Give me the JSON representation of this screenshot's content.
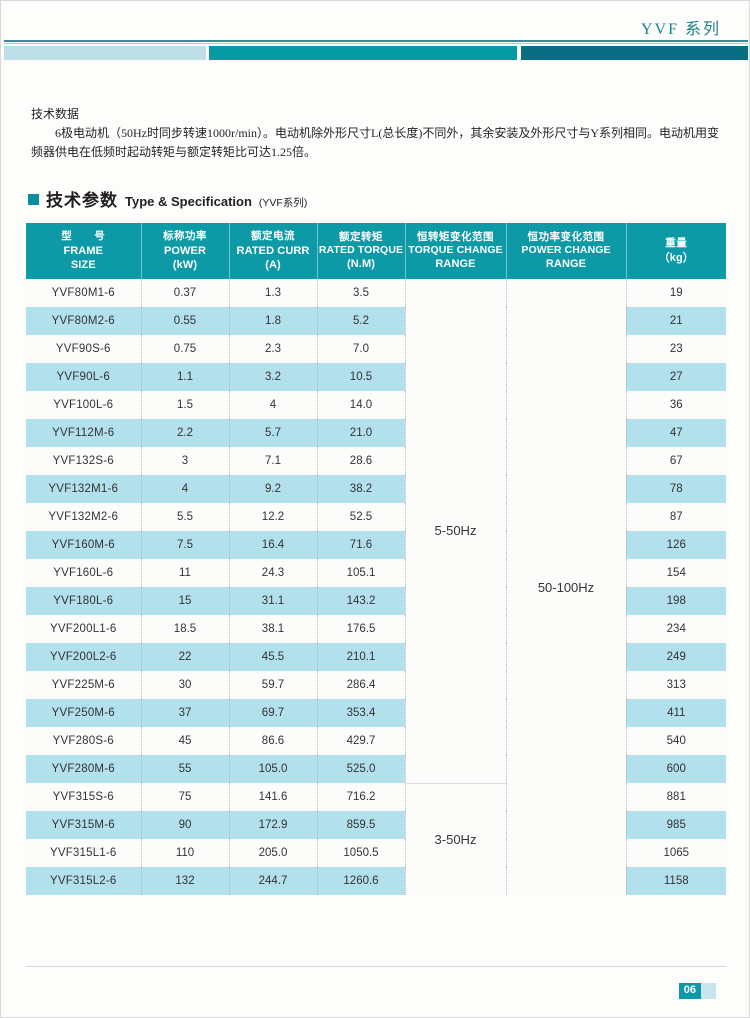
{
  "header": {
    "title": "YVF 系列"
  },
  "intro": {
    "title": "技术数据",
    "body": "6极电动机（50Hz时同步转速1000r/min）。电动机除外形尺寸L(总长度)不同外，其余安装及外形尺寸与Y系列相同。电动机用变频器供电在低频时起动转矩与额定转矩比可达1.25倍。"
  },
  "section": {
    "cn": "技术参数",
    "en": "Type & Specification",
    "sub": "(YVF系列)"
  },
  "table": {
    "columns": [
      {
        "cn": "型　　号",
        "en1": "FRAME",
        "en2": "SIZE"
      },
      {
        "cn": "标称功率",
        "en1": "POWER",
        "en2": "(kW)"
      },
      {
        "cn": "额定电流",
        "en1": "RATED CURR",
        "en2": "(A)"
      },
      {
        "cn": "额定转矩",
        "en1": "RATED TORQUE",
        "en2": "(N.M)"
      },
      {
        "cn": "恒转矩变化范围",
        "en1": "TORQUE CHANGE",
        "en2": "RANGE"
      },
      {
        "cn": "恒功率变化范围",
        "en1": "POWER CHANGE",
        "en2": "RANGE"
      },
      {
        "cn": "重量",
        "en1": "（kg）",
        "en2": ""
      }
    ],
    "rows": [
      {
        "frame": "YVF80M1-6",
        "power": "0.37",
        "current": "1.3",
        "torque": "3.5",
        "weight": "19"
      },
      {
        "frame": "YVF80M2-6",
        "power": "0.55",
        "current": "1.8",
        "torque": "5.2",
        "weight": "21"
      },
      {
        "frame": "YVF90S-6",
        "power": "0.75",
        "current": "2.3",
        "torque": "7.0",
        "weight": "23"
      },
      {
        "frame": "YVF90L-6",
        "power": "1.1",
        "current": "3.2",
        "torque": "10.5",
        "weight": "27"
      },
      {
        "frame": "YVF100L-6",
        "power": "1.5",
        "current": "4",
        "torque": "14.0",
        "weight": "36"
      },
      {
        "frame": "YVF112M-6",
        "power": "2.2",
        "current": "5.7",
        "torque": "21.0",
        "weight": "47"
      },
      {
        "frame": "YVF132S-6",
        "power": "3",
        "current": "7.1",
        "torque": "28.6",
        "weight": "67"
      },
      {
        "frame": "YVF132M1-6",
        "power": "4",
        "current": "9.2",
        "torque": "38.2",
        "weight": "78"
      },
      {
        "frame": "YVF132M2-6",
        "power": "5.5",
        "current": "12.2",
        "torque": "52.5",
        "weight": "87"
      },
      {
        "frame": "YVF160M-6",
        "power": "7.5",
        "current": "16.4",
        "torque": "71.6",
        "weight": "126"
      },
      {
        "frame": "YVF160L-6",
        "power": "11",
        "current": "24.3",
        "torque": "105.1",
        "weight": "154"
      },
      {
        "frame": "YVF180L-6",
        "power": "15",
        "current": "31.1",
        "torque": "143.2",
        "weight": "198"
      },
      {
        "frame": "YVF200L1-6",
        "power": "18.5",
        "current": "38.1",
        "torque": "176.5",
        "weight": "234"
      },
      {
        "frame": "YVF200L2-6",
        "power": "22",
        "current": "45.5",
        "torque": "210.1",
        "weight": "249"
      },
      {
        "frame": "YVF225M-6",
        "power": "30",
        "current": "59.7",
        "torque": "286.4",
        "weight": "313"
      },
      {
        "frame": "YVF250M-6",
        "power": "37",
        "current": "69.7",
        "torque": "353.4",
        "weight": "411"
      },
      {
        "frame": "YVF280S-6",
        "power": "45",
        "current": "86.6",
        "torque": "429.7",
        "weight": "540"
      },
      {
        "frame": "YVF280M-6",
        "power": "55",
        "current": "105.0",
        "torque": "525.0",
        "weight": "600"
      },
      {
        "frame": "YVF315S-6",
        "power": "75",
        "current": "141.6",
        "torque": "716.2",
        "weight": "881"
      },
      {
        "frame": "YVF315M-6",
        "power": "90",
        "current": "172.9",
        "torque": "859.5",
        "weight": "985"
      },
      {
        "frame": "YVF315L1-6",
        "power": "110",
        "current": "205.0",
        "torque": "1050.5",
        "weight": "1065"
      },
      {
        "frame": "YVF315L2-6",
        "power": "132",
        "current": "244.7",
        "torque": "1260.6",
        "weight": "1158"
      }
    ],
    "torque_change_ranges": [
      {
        "value": "5-50Hz",
        "span": 18
      },
      {
        "value": "3-50Hz",
        "span": 4
      }
    ],
    "power_change_ranges": [
      {
        "value": "50-100Hz",
        "span": 22
      }
    ]
  },
  "footer": {
    "page_number": "06"
  },
  "colors": {
    "accent_teal": "#0d9aa6",
    "dark_teal": "#0a6e82",
    "light_blue_row": "#b2e0ec",
    "pale_blue_bar": "#bfdfe8",
    "title_teal": "#1b7f8c"
  }
}
